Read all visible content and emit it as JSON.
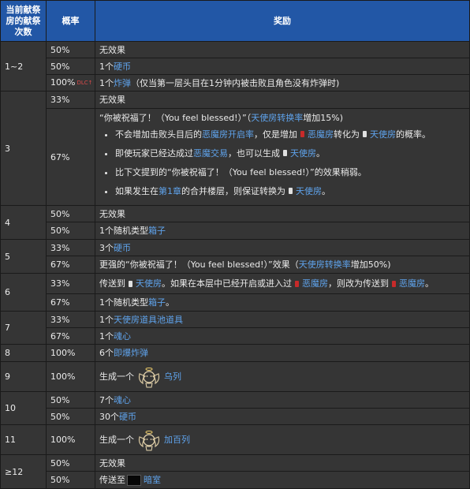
{
  "header": {
    "count": "当前献祭房的献祭次数",
    "prob": "概率",
    "reward": "奖励"
  },
  "groups": {
    "g1": {
      "times": "1~2"
    },
    "g3": {
      "times": "3"
    },
    "g4": {
      "times": "4"
    },
    "g5": {
      "times": "5"
    },
    "g6": {
      "times": "6"
    },
    "g7": {
      "times": "7"
    },
    "g8": {
      "times": "8"
    },
    "g9": {
      "times": "9"
    },
    "g10": {
      "times": "10"
    },
    "g11": {
      "times": "11"
    },
    "g12": {
      "times": "≥12"
    }
  },
  "rows": {
    "r1": {
      "prob": "50%",
      "reward": "无效果"
    },
    "r2": {
      "prob": "50%",
      "pre": "1个",
      "link": "硬币"
    },
    "r3": {
      "prob": "100%",
      "dlc": "DLC↑",
      "pre": "1个",
      "link": "炸弹",
      "post": "（仅当第一层头目在1分钟内被击败且角色没有炸弹时)"
    },
    "r4": {
      "prob": "33%",
      "reward": "无效果"
    },
    "r5": {
      "prob": "67%",
      "main_pre": "“你被祝福了！（You feel blessed!）”（",
      "main_link": "天使房转换率",
      "main_post": "增加15%)",
      "b1_pre": "不会增加击败头目后的",
      "b1_link1": "恶魔房开启率",
      "b1_mid1": "，仅是增加",
      "b1_link2": "恶魔房",
      "b1_mid2": "转化为",
      "b1_link3": "天使房",
      "b1_post": "的概率。",
      "b2_pre": "即使玩家已经达成过",
      "b2_link1": "恶魔交易",
      "b2_mid": "，也可以生成",
      "b2_link2": "天使房",
      "b2_post": "。",
      "b3": "比下文提到的“你被祝福了！（You feel blessed!）”的效果稍弱。",
      "b4_pre": "如果发生在",
      "b4_link1": "第1章",
      "b4_mid": "的合并楼层，则保证转换为",
      "b4_link2": "天使房",
      "b4_post": "。"
    },
    "r6": {
      "prob": "50%",
      "reward": "无效果"
    },
    "r7": {
      "prob": "50%",
      "pre": "1个随机类型",
      "link": "箱子"
    },
    "r8": {
      "prob": "33%",
      "pre": "3个",
      "link": "硬币"
    },
    "r9": {
      "prob": "67%",
      "pre": "更强的“你被祝福了！（You feel blessed!）”效果（",
      "link": "天使房转换率",
      "post": "增加50%)"
    },
    "r10": {
      "prob": "33%",
      "pre": "传送到",
      "link1": "天使房",
      "mid": "。如果在本层中已经开启或进入过",
      "link2": "恶魔房",
      "mid2": "，则改为传送到",
      "link3": "恶魔房",
      "post": "。"
    },
    "r11": {
      "prob": "67%",
      "pre": "1个随机类型",
      "link": "箱子",
      "post": "。"
    },
    "r12": {
      "prob": "33%",
      "pre": "1个",
      "link": "天使房道具池道具"
    },
    "r13": {
      "prob": "67%",
      "pre": "1个",
      "link": "魂心"
    },
    "r14": {
      "prob": "100%",
      "pre": "6个",
      "link": "即爆炸弹"
    },
    "r15": {
      "prob": "100%",
      "pre": "生成一个",
      "link": "乌列"
    },
    "r16": {
      "prob": "50%",
      "pre": "7个",
      "link": "魂心"
    },
    "r17": {
      "prob": "50%",
      "pre": "30个",
      "link": "硬币"
    },
    "r18": {
      "prob": "100%",
      "pre": "生成一个",
      "link": "加百列"
    },
    "r19": {
      "prob": "50%",
      "reward": "无效果"
    },
    "r20": {
      "prob": "50%",
      "pre": "传送至",
      "link": "暗室"
    }
  },
  "colors": {
    "header_bg": "#2257a6",
    "cell_bg": "#353535",
    "border": "#1a1a1a",
    "link": "#5fa3ec",
    "text": "#ebebeb",
    "dlc": "#d94a4a",
    "icon_red": "#c72a2a"
  },
  "icons": [
    "white-room-icon",
    "red-room-icon",
    "angel-icon",
    "dark-room-icon"
  ]
}
